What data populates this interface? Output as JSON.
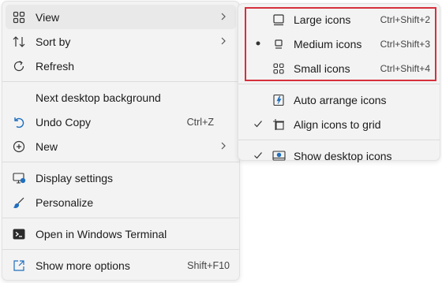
{
  "main_menu": {
    "view": "View",
    "sort_by": "Sort by",
    "refresh": "Refresh",
    "next_background": "Next desktop background",
    "undo_copy": "Undo Copy",
    "undo_copy_shortcut": "Ctrl+Z",
    "new": "New",
    "display_settings": "Display settings",
    "personalize": "Personalize",
    "open_terminal": "Open in Windows Terminal",
    "show_more_options": "Show more options",
    "show_more_shortcut": "Shift+F10"
  },
  "view_submenu": {
    "large_icons": "Large icons",
    "large_icons_shortcut": "Ctrl+Shift+2",
    "medium_icons": "Medium icons",
    "medium_icons_shortcut": "Ctrl+Shift+3",
    "small_icons": "Small icons",
    "small_icons_shortcut": "Ctrl+Shift+4",
    "auto_arrange": "Auto arrange icons",
    "align_to_grid": "Align icons to grid",
    "show_desktop_icons": "Show desktop icons",
    "selected_size": "Medium icons",
    "align_to_grid_checked": true,
    "show_desktop_icons_checked": true
  },
  "colors": {
    "menu_bg": "#f3f3f3",
    "hover_bg": "#e9e9e9",
    "highlight_border": "#d6303d",
    "accent_icon": "#1f6fbf"
  }
}
